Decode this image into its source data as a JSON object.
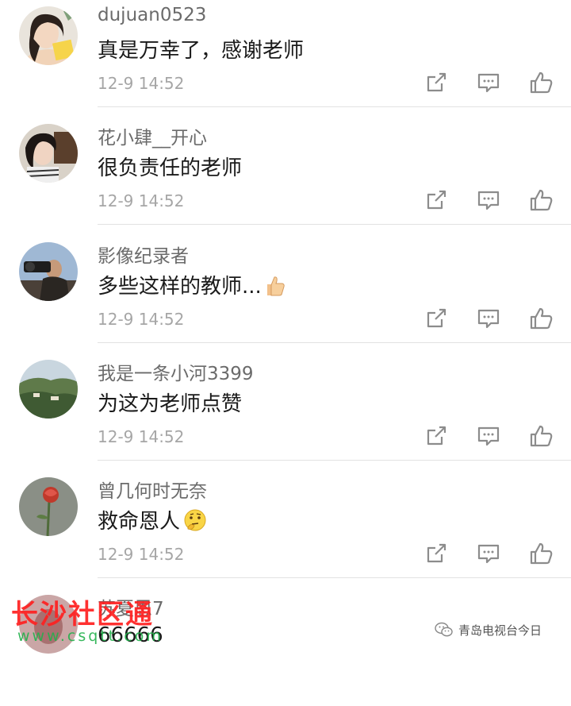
{
  "comments": [
    {
      "username": "dujuan0523",
      "text": "真是万幸了，感谢老师",
      "time": "12-9 14:52",
      "avatar": "avatar-girl-yellow"
    },
    {
      "username": "花小肆__开心",
      "text": "很负责任的老师",
      "time": "12-9 14:52",
      "avatar": "avatar-girl-hat"
    },
    {
      "username": "影像纪录者",
      "text": "多些这样的教师...",
      "time": "12-9 14:52",
      "avatar": "avatar-photographer",
      "emoji": "thumbs-up-emoji"
    },
    {
      "username": "我是一条小河3399",
      "text": "为这为老师点赞",
      "time": "12-9 14:52",
      "avatar": "avatar-landscape"
    },
    {
      "username": "曾几何时无奈",
      "text": "救命恩人",
      "time": "12-9 14:52",
      "avatar": "avatar-rose",
      "emoji": "thinking-face-emoji"
    },
    {
      "username": "苏夏恩7",
      "text": "66666",
      "avatar": "avatar-partial"
    }
  ],
  "action_icons": [
    "share-icon",
    "reply-icon",
    "like-icon"
  ],
  "watermark": {
    "site_name": "长沙社区通",
    "site_url": "www.csqtt.com",
    "account": "青岛电视台今日",
    "account_icon": "wechat-icon"
  },
  "colors": {
    "username": "#6b6b6b",
    "text": "#1a1a1a",
    "timestamp": "#a6a6a6",
    "icon": "#8c8c8c",
    "watermark_red": "#ff2020",
    "watermark_green": "#22b14c"
  }
}
